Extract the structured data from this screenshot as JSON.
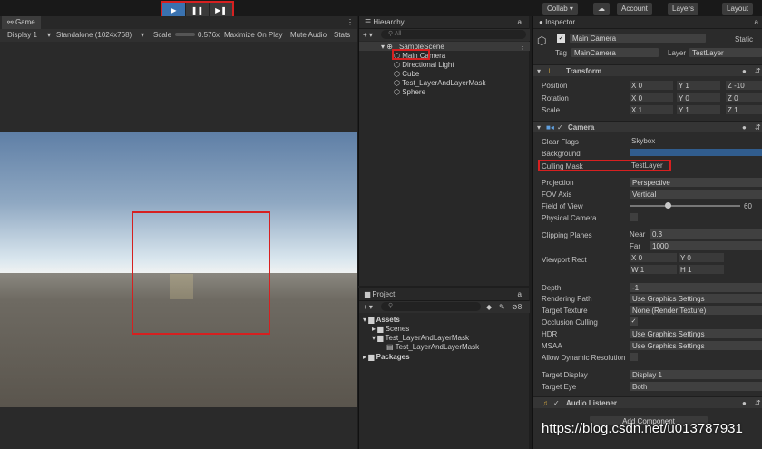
{
  "toolbar": {
    "play": "▶",
    "pause": "❚❚",
    "step": "▶❚",
    "collab": "Collab ▾",
    "account": "Account",
    "layers": "Layers",
    "layout": "Layout"
  },
  "game": {
    "tab": "Game",
    "display": "Display 1",
    "resolution": "Standalone (1024x768)",
    "scale_label": "Scale",
    "scale_value": "0.576x",
    "maximize": "Maximize On Play",
    "mute": "Mute Audio",
    "stats": "Stats"
  },
  "hierarchy": {
    "tab": "Hierarchy",
    "search_placeholder": "All",
    "scene": "SampleScene",
    "items": [
      "Main Camera",
      "Directional Light",
      "Cube",
      "Test_LayerAndLayerMask",
      "Sphere"
    ]
  },
  "project": {
    "tab": "Project",
    "count": "8",
    "assets": "Assets",
    "scenes": "Scenes",
    "folder": "Test_LayerAndLayerMask",
    "script": "Test_LayerAndLayerMask",
    "packages": "Packages"
  },
  "inspector": {
    "tab": "Inspector",
    "object_name": "Main Camera",
    "static": "Static",
    "tag_label": "Tag",
    "tag_value": "MainCamera",
    "layer_label": "Layer",
    "layer_value": "TestLayer",
    "transform": {
      "title": "Transform",
      "position_label": "Position",
      "position": [
        "0",
        "1",
        "-10"
      ],
      "rotation_label": "Rotation",
      "rotation": [
        "0",
        "0",
        "0"
      ],
      "scale_label": "Scale",
      "scale": [
        "1",
        "1",
        "1"
      ]
    },
    "camera": {
      "title": "Camera",
      "clear_flags_label": "Clear Flags",
      "clear_flags": "Skybox",
      "background_label": "Background",
      "culling_mask_label": "Culling Mask",
      "culling_mask": "TestLayer",
      "projection_label": "Projection",
      "projection": "Perspective",
      "fov_axis_label": "FOV Axis",
      "fov_axis": "Vertical",
      "fov_label": "Field of View",
      "fov": "60",
      "physical_label": "Physical Camera",
      "clipping_label": "Clipping Planes",
      "near_label": "Near",
      "near": "0.3",
      "far_label": "Far",
      "far": "1000",
      "viewport_label": "Viewport Rect",
      "vx": "0",
      "vy": "0",
      "vw": "1",
      "vh": "1",
      "depth_label": "Depth",
      "depth": "-1",
      "rendering_path_label": "Rendering Path",
      "rendering_path": "Use Graphics Settings",
      "target_texture_label": "Target Texture",
      "target_texture": "None (Render Texture)",
      "occlusion_label": "Occlusion Culling",
      "hdr_label": "HDR",
      "hdr": "Use Graphics Settings",
      "msaa_label": "MSAA",
      "msaa": "Use Graphics Settings",
      "dyn_res_label": "Allow Dynamic Resolution",
      "target_display_label": "Target Display",
      "target_display": "Display 1",
      "target_eye_label": "Target Eye",
      "target_eye": "Both"
    },
    "audio_listener": "Audio Listener",
    "add_component": "Add Component"
  },
  "watermark": "https://blog.csdn.net/u013787931"
}
